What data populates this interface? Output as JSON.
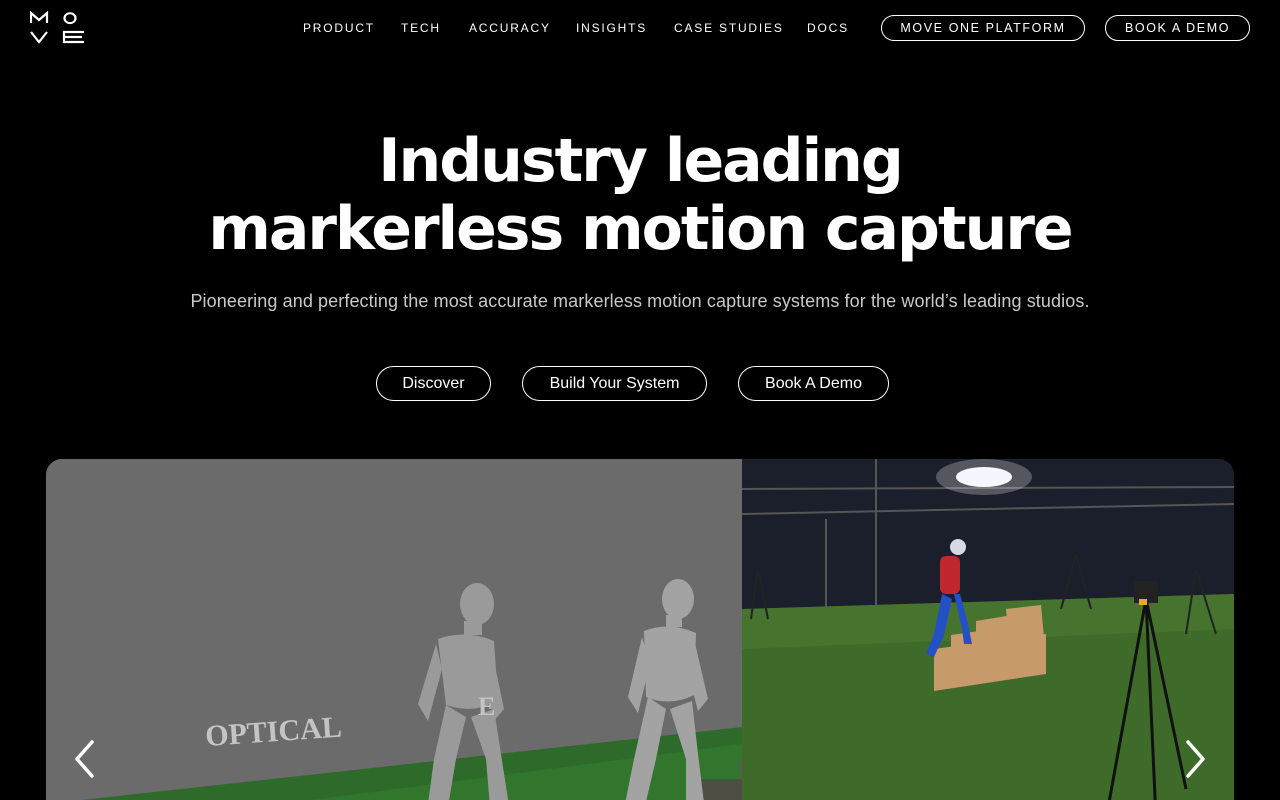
{
  "brand": {
    "logo_text": "MOVE"
  },
  "nav": {
    "links": [
      "PRODUCT",
      "TECH",
      "ACCURACY",
      "INSIGHTS",
      "CASE STUDIES",
      "DOCS"
    ],
    "platform_button": "MOVE ONE PLATFORM",
    "demo_button": "BOOK A DEMO"
  },
  "hero": {
    "title_line1": "Industry leading",
    "title_line2": "markerless motion capture",
    "subtitle": "Pioneering and perfecting the most accurate markerless motion capture systems for the world’s leading studios.",
    "buttons": [
      "Discover",
      "Build Your System",
      "Book A Demo"
    ]
  },
  "media": {
    "label_left": "OPTICAL",
    "prev_icon": "chevron-left-icon",
    "next_icon": "chevron-right-icon"
  },
  "colors": {
    "background": "#000000",
    "text": "#ffffff",
    "subtitle": "#c9c9c9",
    "turf": "#3f6b2a"
  }
}
